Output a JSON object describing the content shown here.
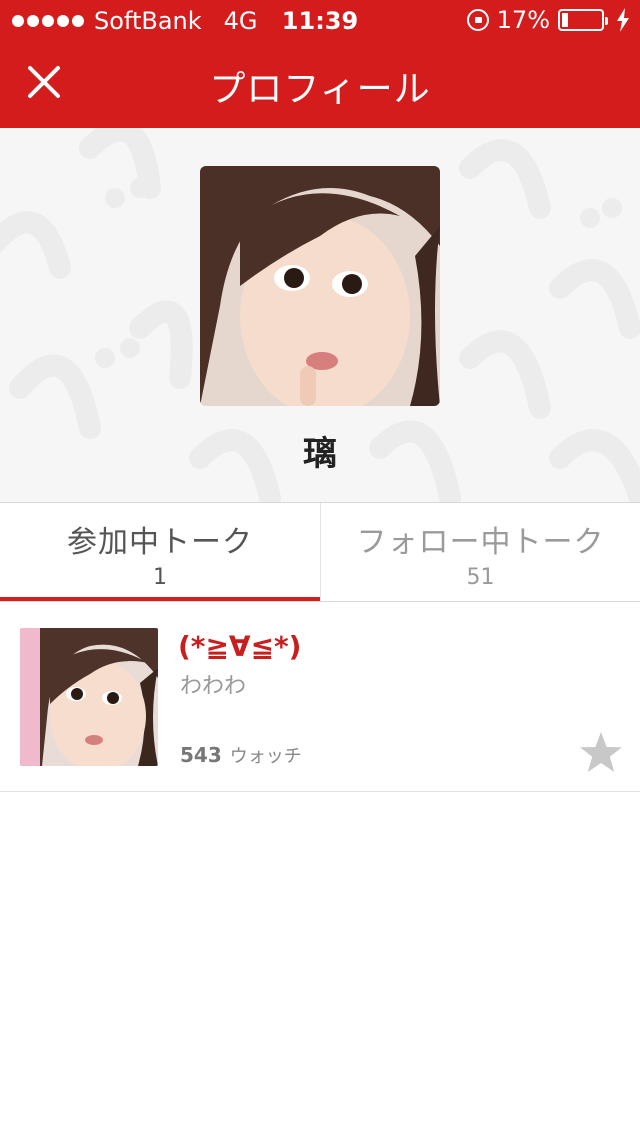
{
  "status_bar": {
    "carrier": "SoftBank",
    "network": "4G",
    "time": "11:39",
    "battery_percent": "17%",
    "battery_level": 0.17,
    "signal_bars": 5
  },
  "nav": {
    "title": "プロフィール",
    "close_icon": "close-icon"
  },
  "profile": {
    "name": "璃",
    "avatar_icon": "profile-photo"
  },
  "tabs": [
    {
      "label": "参加中トーク",
      "count": "1",
      "active": true
    },
    {
      "label": "フォロー中トーク",
      "count": "51",
      "active": false
    }
  ],
  "talks": [
    {
      "title": "(*≧∀≦*)",
      "subtitle": "わわわ",
      "watch_count": "543",
      "watch_label": "ウォッチ",
      "favorite_icon": "star-icon"
    }
  ],
  "colors": {
    "brand_red": "#d41c1c",
    "title_red": "#c81e1e",
    "muted_text": "#999999"
  }
}
